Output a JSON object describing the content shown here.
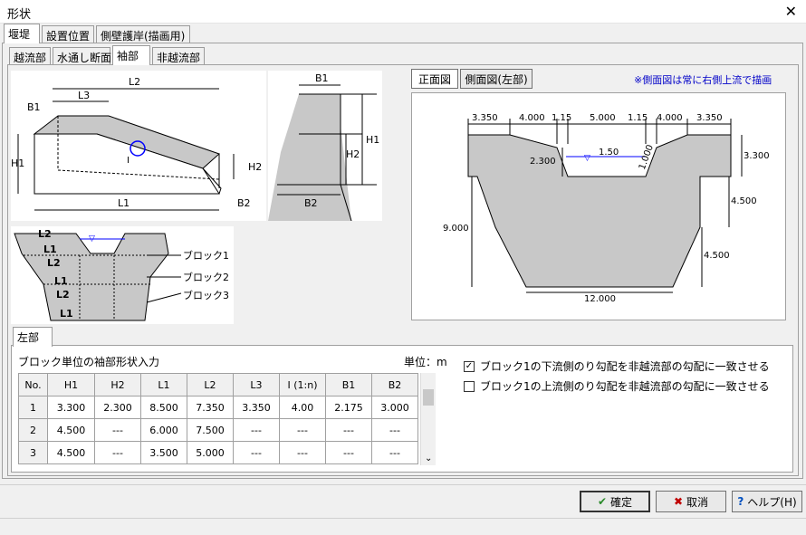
{
  "window": {
    "title": "形状",
    "close_icon": "close-icon"
  },
  "tabs_top": [
    "堰堤",
    "設置位置",
    "側壁護岸(描画用)"
  ],
  "tabs_sub": [
    "越流部",
    "水通し断面",
    "袖部",
    "非越流部"
  ],
  "view_buttons": [
    "正面図",
    "側面図(左部)"
  ],
  "note": "※側面図は常に右側上流で描画",
  "iso_labels": {
    "L2": "L2",
    "L3": "L3",
    "B1": "B1",
    "H1": "H1",
    "H2": "H2",
    "L1": "L1",
    "B2": "B2",
    "I": "I"
  },
  "side_labels": {
    "B1": "B1",
    "H1": "H1",
    "H2": "H2",
    "B2": "B2"
  },
  "block_labels": {
    "rows": [
      "L2",
      "L1",
      "L2",
      "L1",
      "L2",
      "L1"
    ],
    "blocks": [
      "ブロック1",
      "ブロック2",
      "ブロック3"
    ]
  },
  "front": {
    "top_dims": [
      "3.350",
      "4.000",
      "1.15",
      "5.000",
      "1.15",
      "4.000",
      "3.350"
    ],
    "d_2300": "2.300",
    "d_150": "1.50",
    "d_1000": "1.000",
    "d_3300": "3.300",
    "d_4500a": "4.500",
    "d_4500b": "4.500",
    "d_9000": "9.000",
    "d_12000": "12.000"
  },
  "section_tab": "左部",
  "table_title": "ブロック単位の袖部形状入力",
  "unit": "単位：m",
  "table": {
    "headers": [
      "No.",
      "H1",
      "H2",
      "L1",
      "L2",
      "L3",
      "I (1:n)",
      "B1",
      "B2"
    ],
    "rows": [
      [
        "1",
        "3.300",
        "2.300",
        "8.500",
        "7.350",
        "3.350",
        "4.00",
        "2.175",
        "3.000"
      ],
      [
        "2",
        "4.500",
        "---",
        "6.000",
        "7.500",
        "---",
        "---",
        "---",
        "---"
      ],
      [
        "3",
        "4.500",
        "---",
        "3.500",
        "5.000",
        "---",
        "---",
        "---",
        "---"
      ]
    ]
  },
  "checks": [
    {
      "label": "ブロック1の下流側のり勾配を非越流部の勾配に一致させる",
      "checked": true
    },
    {
      "label": "ブロック1の上流側のり勾配を非越流部の勾配に一致させる",
      "checked": false
    }
  ],
  "buttons": {
    "ok": "確定",
    "cancel": "取消",
    "help": "ヘルプ(H)"
  },
  "colors": {
    "shape_fill": "#c8c8c8",
    "note_color": "#0000c8",
    "water_line": "#0000ff"
  }
}
